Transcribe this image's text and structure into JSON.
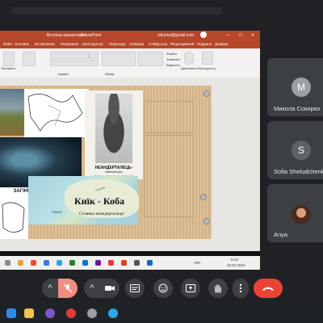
{
  "powerpoint": {
    "title_left": "Вступна презентація",
    "title_app": "PowerPoint",
    "account": "sokyrko@gmail.com",
    "menu": [
      "Файл",
      "Основне",
      "Вставлення",
      "Рисування",
      "Конструктор",
      "Переходи",
      "Анімація",
      "Слайд-шоу",
      "Рецензування",
      "Подання",
      "Довідка",
      "Скажіть, що потрібно зробити"
    ],
    "ribbon_groups": [
      "Буфер обміну",
      "Слайди",
      "Шрифт",
      "Абзац",
      "Рисування",
      "Редагування",
      "Диктування",
      "Конструктор"
    ],
    "ribbon_buttons": {
      "paste": "Вставити",
      "new_slide": "Створити слайд",
      "reuse": "Повторне використання",
      "find": "Знайти",
      "replace": "Замінити",
      "select": "Виділити",
      "dictate": "Диктувати",
      "designer": "Конструктор"
    }
  },
  "slide": {
    "neanderthal_title": "НЕАНДЕРТАЛЕЦЬ-",
    "neanderthal_sub": "палеоантроп",
    "neanderthal_sub2": "(людина, схожа на неандертальця)",
    "hunt_label": "ЗАГІННЕ ПОЛЮВАННЯ",
    "kiik_label": "Киїк - Коба",
    "site_label": "Стоянка неандертальця",
    "sea_label": "Чорне",
    "river_label": "Салгир"
  },
  "inner_taskbar": {
    "time": "9:44",
    "date": "22.02.2024",
    "lang": "УКР"
  },
  "participants": [
    {
      "initial": "M",
      "name": "Микола Сокирко",
      "avatar_color": "#9aa0a6"
    },
    {
      "initial": "S",
      "name": "Sofia Sheludchenko",
      "avatar_color": "#5f6368"
    },
    {
      "initial": "",
      "name": "Anya",
      "avatar_color": "#6b4a3a"
    }
  ],
  "controls": {
    "mic_icon": "mic-off-icon",
    "camera_icon": "camera-icon",
    "captions_icon": "captions-icon",
    "emoji_icon": "emoji-icon",
    "present_icon": "present-icon",
    "hand_icon": "raise-hand-icon",
    "more_icon": "more-vert-icon",
    "end_icon": "call-end-icon",
    "end_color": "#ea4335",
    "mic_color": "#f28b82"
  }
}
